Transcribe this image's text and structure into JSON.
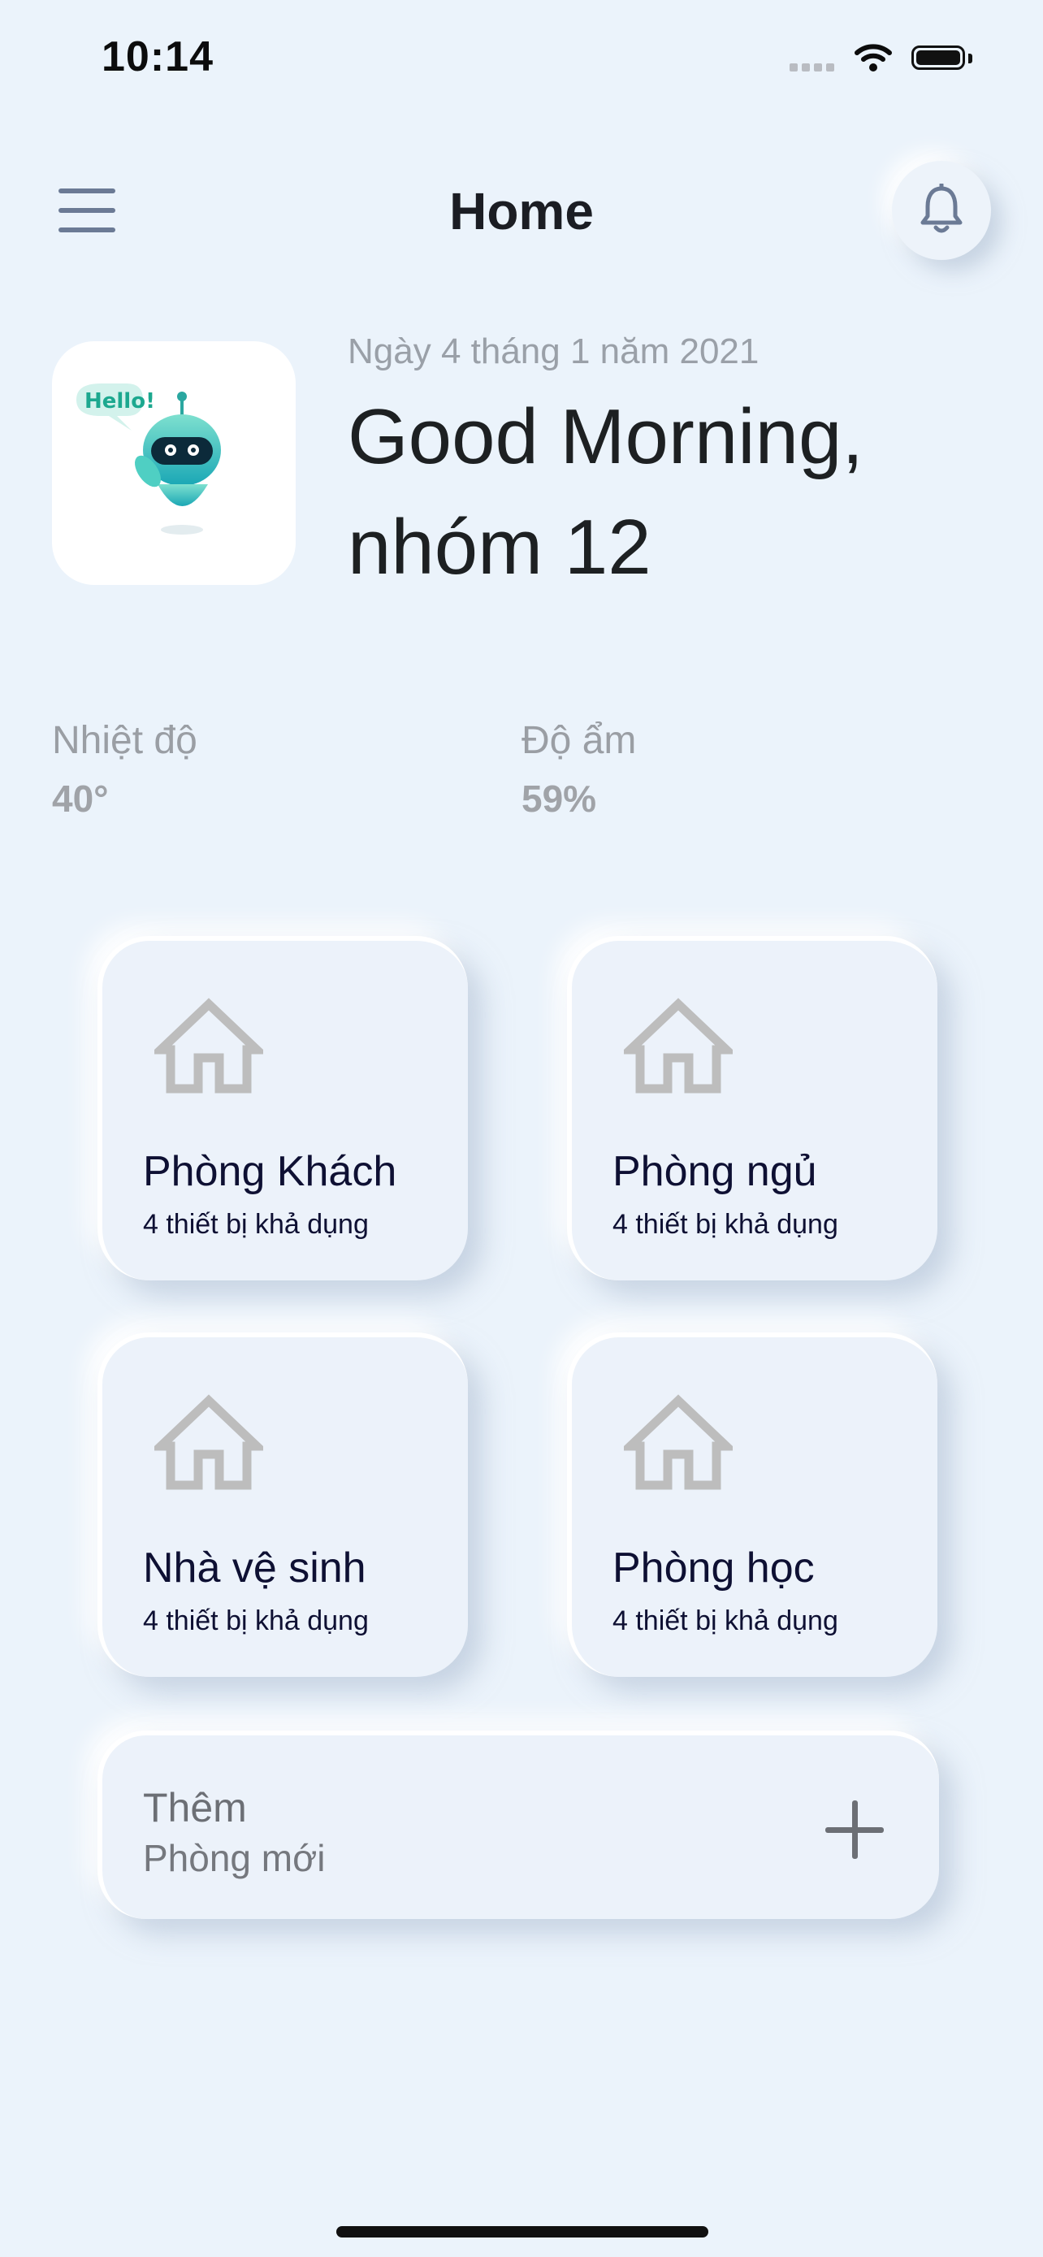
{
  "status_bar": {
    "time": "10:14"
  },
  "header": {
    "title": "Home"
  },
  "greeting": {
    "date": "Ngày 4 tháng 1 năm 2021",
    "line1": "Good Morning,",
    "line2": "nhóm 12",
    "avatar_text": "Hello!"
  },
  "stats": {
    "temperature": {
      "label": "Nhiệt độ",
      "value": "40°"
    },
    "humidity": {
      "label": "Độ ẩm",
      "value": "59%"
    }
  },
  "rooms": [
    {
      "name": "Phòng Khách",
      "devices": "4 thiết bị khả dụng"
    },
    {
      "name": "Phòng ngủ",
      "devices": "4 thiết bị khả dụng"
    },
    {
      "name": "Nhà vệ sinh",
      "devices": "4 thiết bị khả dụng"
    },
    {
      "name": "Phòng học",
      "devices": "4 thiết bị khả dụng"
    }
  ],
  "add_room": {
    "line1": "Thêm",
    "line2": "Phòng mới"
  },
  "colors": {
    "background": "#ebf3fb",
    "card": "#ecf2fa",
    "room_title": "#0e1033",
    "icon_gray": "#bdbdbd"
  },
  "icons": [
    "menu-icon",
    "bell-icon",
    "house-icon",
    "plus-icon",
    "wifi-icon",
    "battery-icon"
  ]
}
